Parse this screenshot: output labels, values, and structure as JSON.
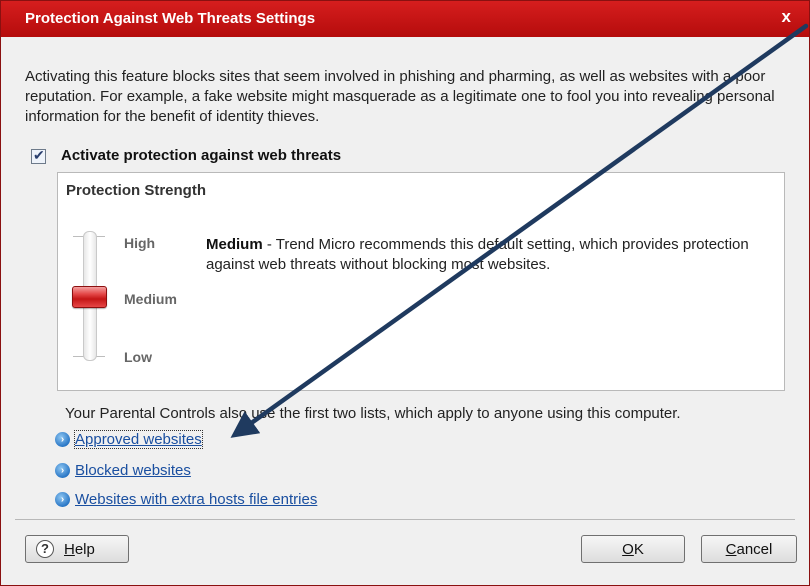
{
  "window": {
    "title": "Protection Against Web Threats Settings",
    "close_glyph": "x"
  },
  "intro": "Activating this feature blocks sites that seem involved in phishing and pharming, as well as websites with a poor reputation. For example, a fake website might masquerade as a legitimate one to fool you into revealing personal information for the benefit of identity thieves.",
  "activate": {
    "label": "Activate protection against web threats",
    "checked": true
  },
  "strength": {
    "title": "Protection Strength",
    "levels": [
      "High",
      "Medium",
      "Low"
    ],
    "selected": "Medium",
    "description_level": "Medium",
    "description_text": " - Trend Micro recommends this default setting, which provides protection against web threats without blocking most websites."
  },
  "parental_note": "Your Parental Controls also use the first two lists, which apply to anyone using this computer.",
  "links": [
    {
      "label": "Approved websites"
    },
    {
      "label": "Blocked websites"
    },
    {
      "label": "Websites with extra hosts file entries"
    }
  ],
  "buttons": {
    "help": "Help",
    "help_icon": "?",
    "ok": "OK",
    "cancel": "Cancel"
  },
  "colors": {
    "titlebar": "#c81414",
    "link": "#1a4fa0",
    "annotation_arrow": "#1f3a5f"
  },
  "icons": {
    "close": "close-icon",
    "link": "chevron-right-circle-icon",
    "help": "question-icon",
    "check": "checkmark-icon"
  }
}
